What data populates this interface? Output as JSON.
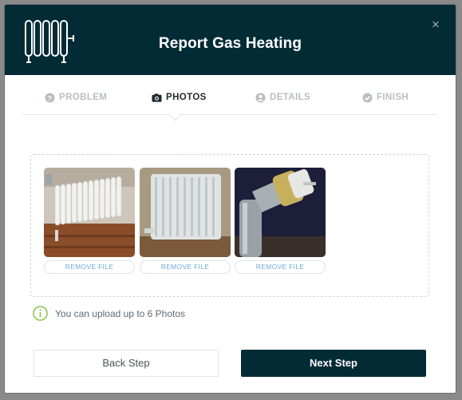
{
  "colors": {
    "brand": "#032b36",
    "active_step": "#1f2a30",
    "inactive_step": "#b9bec1",
    "link": "#6fa9d8",
    "hint_icon": "#8bc34a"
  },
  "header": {
    "title": "Report Gas Heating",
    "logo": "radiator-logo-icon",
    "close_label": "×"
  },
  "steps": [
    {
      "label": "PROBLEM",
      "icon": "question-circle-icon",
      "active": false
    },
    {
      "label": "PHOTOS",
      "icon": "camera-icon",
      "active": true
    },
    {
      "label": "DETAILS",
      "icon": "user-circle-icon",
      "active": false
    },
    {
      "label": "FINISH",
      "icon": "check-circle-icon",
      "active": false
    }
  ],
  "photos": [
    {
      "image": "white-column-radiator-photo",
      "remove_label": "REMOVE FILE"
    },
    {
      "image": "cast-iron-radiator-photo",
      "remove_label": "REMOVE FILE"
    },
    {
      "image": "radiator-valve-photo",
      "remove_label": "REMOVE FILE"
    }
  ],
  "hint": {
    "icon": "info-circle-icon",
    "text": "You can upload up to 6 Photos"
  },
  "buttons": {
    "back_label": "Back Step",
    "next_label": "Next Step"
  }
}
